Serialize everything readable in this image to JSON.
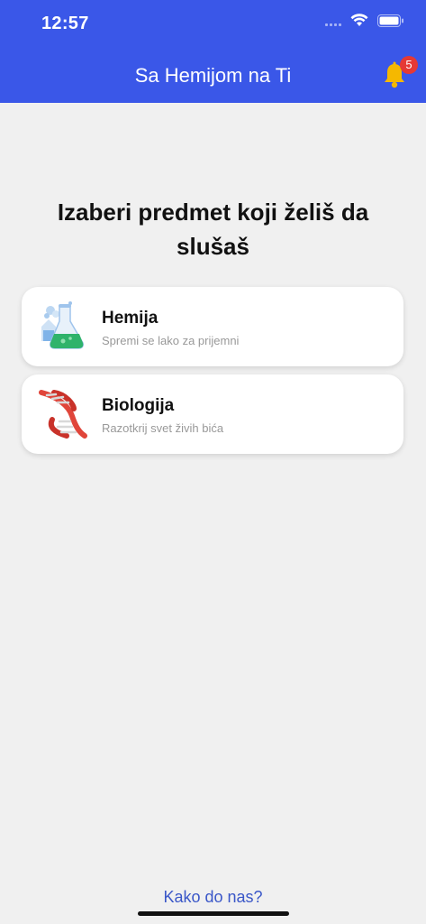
{
  "status_bar": {
    "time": "12:57"
  },
  "header": {
    "title": "Sa Hemijom na Ti",
    "notification_count": "5",
    "background_color": "#3a57e8"
  },
  "main": {
    "heading": "Izaberi predmet koji želiš da slušaš",
    "subjects": [
      {
        "title": "Hemija",
        "subtitle": "Spremi se lako za prijemni",
        "icon": "chemistry-flask-icon"
      },
      {
        "title": "Biologija",
        "subtitle": "Razotkrij svet živih bića",
        "icon": "dna-icon"
      }
    ]
  },
  "footer": {
    "link_label": "Kako do nas?"
  }
}
